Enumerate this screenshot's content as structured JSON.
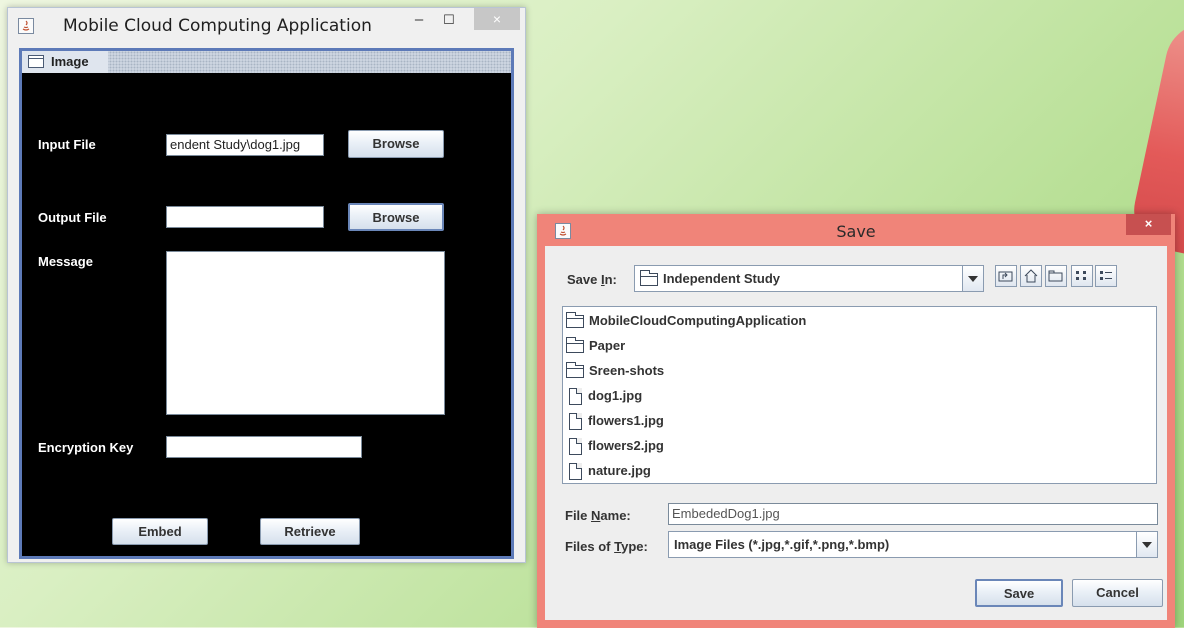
{
  "main_window": {
    "title": "Mobile Cloud Computing Application",
    "minimize_glyph": "–",
    "maximize_glyph": "☐",
    "close_glyph": "×",
    "internal_frame": {
      "title": "Image",
      "input_file_label": "Input File",
      "input_file_value": "endent Study\\dog1.jpg",
      "browse_label": "Browse",
      "output_file_label": "Output File",
      "output_file_value": "",
      "message_label": "Message",
      "message_value": "",
      "encryption_key_label": "Encryption Key",
      "encryption_key_value": "",
      "embed_label": "Embed",
      "retrieve_label": "Retrieve"
    }
  },
  "save_dialog": {
    "title": "Save",
    "close_glyph": "×",
    "save_in_label_pre": "Save ",
    "save_in_label_mnemonic": "I",
    "save_in_label_post": "n:",
    "save_in_value": "Independent Study",
    "files": [
      {
        "name": "MobileCloudComputingApplication",
        "kind": "folder"
      },
      {
        "name": "Paper",
        "kind": "folder"
      },
      {
        "name": "Sreen-shots",
        "kind": "folder"
      },
      {
        "name": "dog1.jpg",
        "kind": "file"
      },
      {
        "name": "flowers1.jpg",
        "kind": "file"
      },
      {
        "name": "flowers2.jpg",
        "kind": "file"
      },
      {
        "name": "nature.jpg",
        "kind": "file"
      }
    ],
    "file_name_label_pre": "File ",
    "file_name_label_mnemonic": "N",
    "file_name_label_post": "ame:",
    "file_name_value": "EmbededDog1.jpg",
    "files_of_type_label_pre": "Files of ",
    "files_of_type_label_mnemonic": "T",
    "files_of_type_label_post": "ype:",
    "files_of_type_value": "Image Files (*.jpg,*.gif,*.png,*.bmp)",
    "save_button": "Save",
    "cancel_button": "Cancel"
  },
  "colors": {
    "dialog_border": "#f08479",
    "dialog_close": "#c75050",
    "internal_frame_border": "#5d7ab8",
    "panel_background": "#000000"
  }
}
